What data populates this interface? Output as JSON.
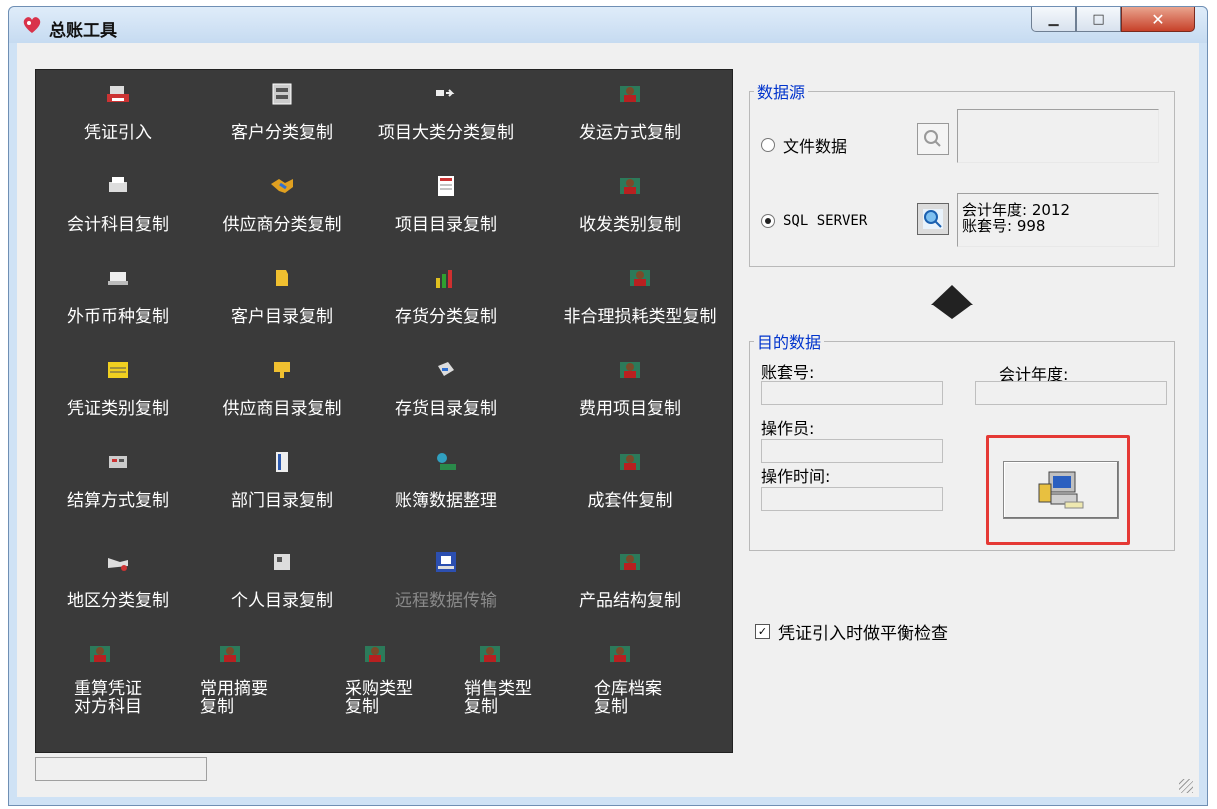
{
  "window": {
    "title": "总账工具",
    "minimize_symbol": "▁",
    "maximize_symbol": "□",
    "close_symbol": "✕"
  },
  "tools": {
    "row1": [
      "凭证引入",
      "客户分类复制",
      "项目大类分类复制",
      "发运方式复制"
    ],
    "row2": [
      "会计科目复制",
      "供应商分类复制",
      "项目目录复制",
      "收发类别复制"
    ],
    "row3": [
      "外币币种复制",
      "客户目录复制",
      "存货分类复制",
      "非合理损耗类型复制"
    ],
    "row4": [
      "凭证类别复制",
      "供应商目录复制",
      "存货目录复制",
      "费用项目复制"
    ],
    "row5": [
      "结算方式复制",
      "部门目录复制",
      "账簿数据整理",
      "成套件复制"
    ],
    "row6": [
      "地区分类复制",
      "个人目录复制",
      "远程数据传输",
      "产品结构复制"
    ],
    "row7": [
      "重算凭证\n对方科目",
      "常用摘要\n复制",
      "采购类型\n复制",
      "销售类型\n复制",
      "仓库档案\n复制"
    ]
  },
  "source": {
    "legend": "数据源",
    "file_option": "文件数据",
    "sql_option": "SQL SERVER",
    "selected": "SQL SERVER",
    "fiscal_year_line": "会计年度: 2012",
    "account_set_line": "账套号: 998"
  },
  "target": {
    "legend": "目的数据",
    "account_set_label": "账套号:",
    "fiscal_year_label": "会计年度:",
    "operator_label": "操作员:",
    "operate_time_label": "操作时间:"
  },
  "options": {
    "balance_check_label": "凭证引入时做平衡检查",
    "balance_check_checked": true,
    "check_mark": "✓"
  },
  "colors": {
    "panel_bg": "#3a3a3a",
    "legend_blue": "#0033cc",
    "highlight_red": "#e53935"
  },
  "icons": {
    "arrow": "down-arrow-icon",
    "run": "computer-transfer-icon"
  }
}
